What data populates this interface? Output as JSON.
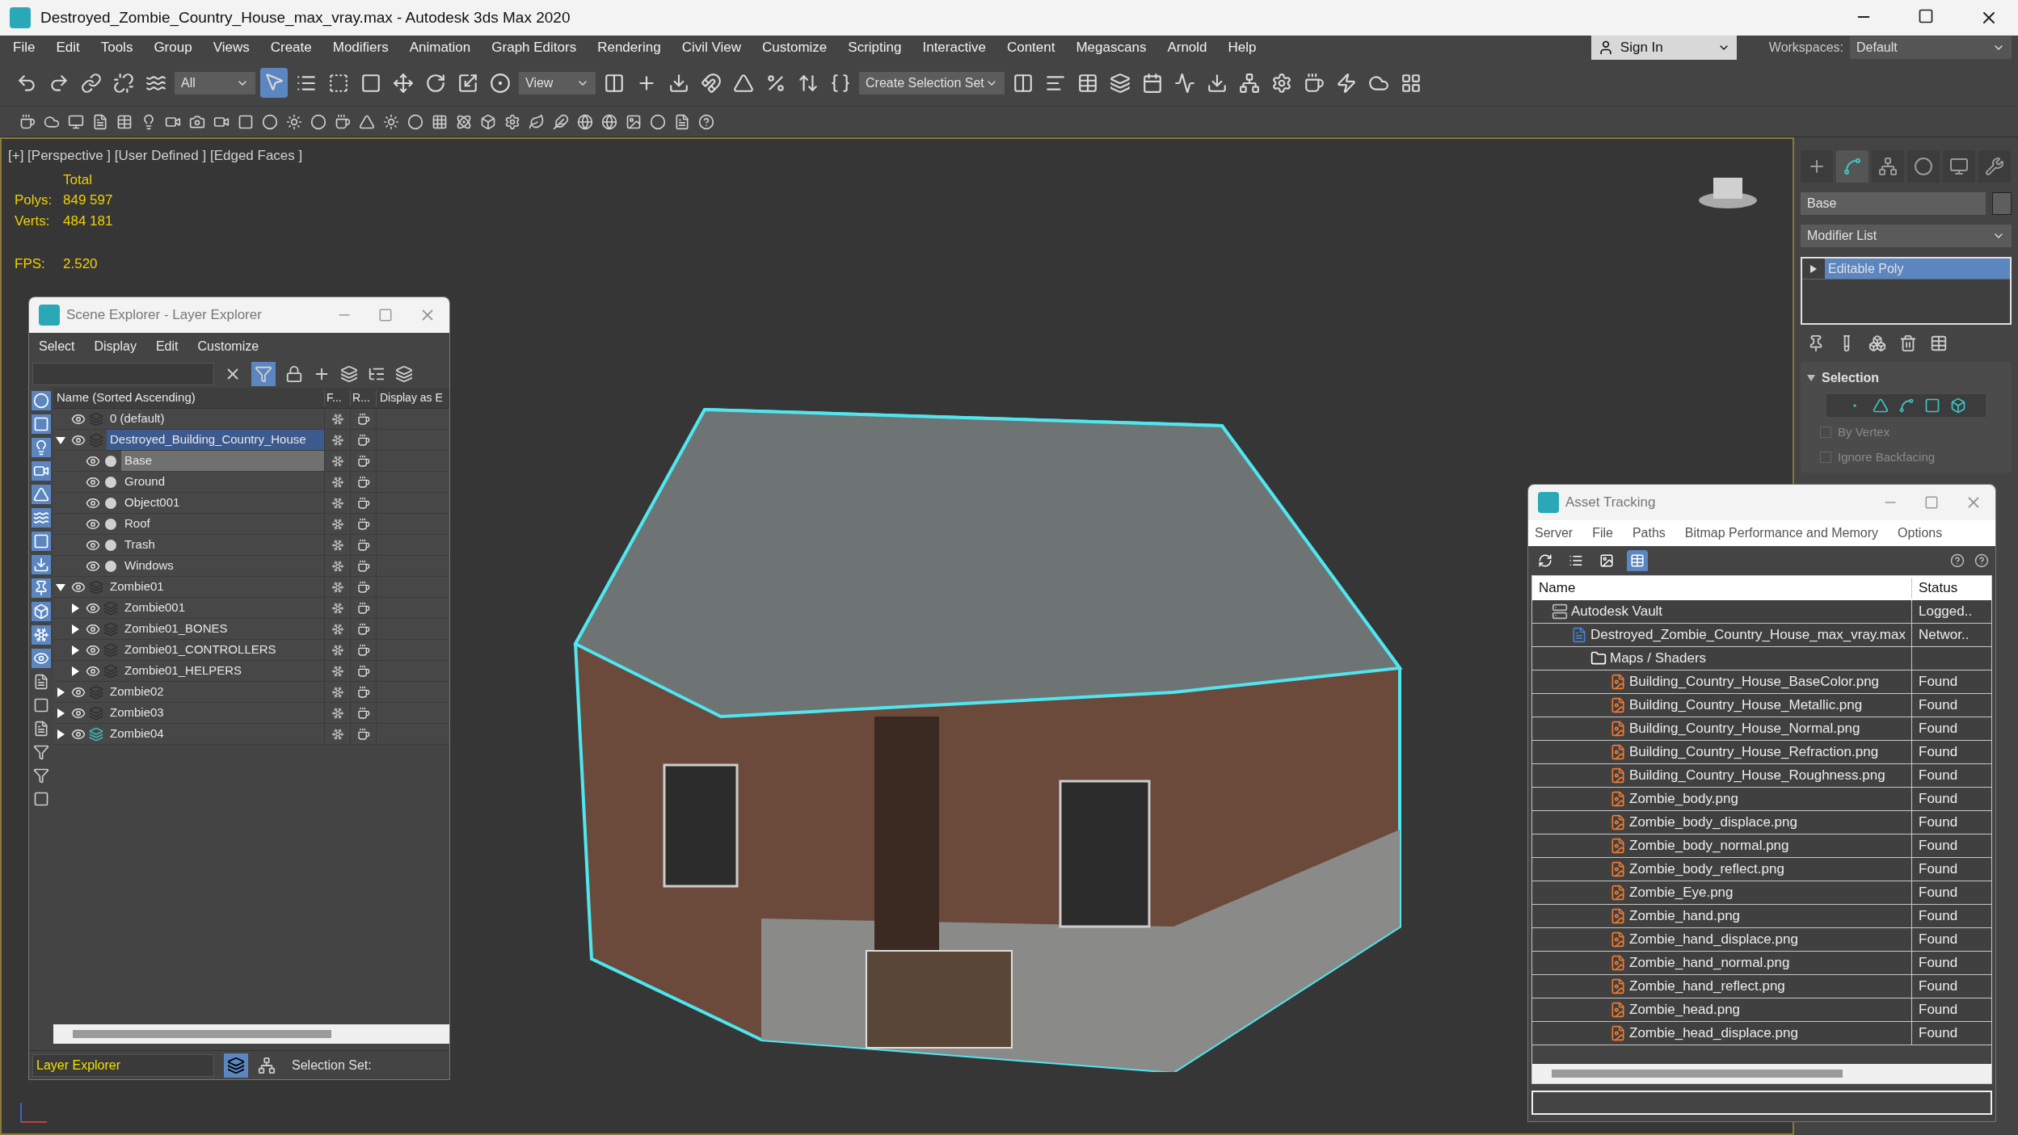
{
  "window": {
    "title": "Destroyed_Zombie_Country_House_max_vray.max - Autodesk 3ds Max 2020"
  },
  "menu": [
    "File",
    "Edit",
    "Tools",
    "Group",
    "Views",
    "Create",
    "Modifiers",
    "Animation",
    "Graph Editors",
    "Rendering",
    "Civil View",
    "Customize",
    "Scripting",
    "Interactive",
    "Content",
    "Megascans",
    "Arnold",
    "Help"
  ],
  "toolbar": {
    "selection_filter": "All",
    "reference_coord": "View",
    "selection_set": "Create Selection Set"
  },
  "account": {
    "sign_in": "Sign In",
    "workspaces_label": "Workspaces:",
    "workspace": "Default"
  },
  "viewport": {
    "labels": "[+] [Perspective ] [User Defined ] [Edged Faces ]",
    "stats_header": "Total",
    "stats": [
      {
        "label": "Polys:",
        "value": "849 597"
      },
      {
        "label": "Verts:",
        "value": "484 181"
      },
      {
        "label": "FPS:",
        "value": "2.520"
      }
    ]
  },
  "scene_explorer": {
    "title": "Scene Explorer - Layer Explorer",
    "menu": [
      "Select",
      "Display",
      "Edit",
      "Customize"
    ],
    "columns": [
      "Name (Sorted Ascending)",
      "F...",
      "R...",
      "Display as E"
    ],
    "tree": [
      {
        "name": "0 (default)",
        "kind": "layer",
        "selected": false,
        "current": false
      },
      {
        "name": "Destroyed_Building_Country_House",
        "kind": "layer",
        "expanded": true,
        "selected": true,
        "current": false,
        "children": [
          {
            "name": "Base",
            "kind": "object",
            "selected": true
          },
          {
            "name": "Ground",
            "kind": "object",
            "selected": false
          },
          {
            "name": "Object001",
            "kind": "object",
            "selected": false
          },
          {
            "name": "Roof",
            "kind": "object",
            "selected": false
          },
          {
            "name": "Trash",
            "kind": "object",
            "selected": false
          },
          {
            "name": "Windows",
            "kind": "object",
            "selected": false
          }
        ]
      },
      {
        "name": "Zombie01",
        "kind": "layer",
        "expanded": true,
        "selected": false,
        "current": false,
        "children": [
          {
            "name": "Zombie001",
            "kind": "layer",
            "expanded": false,
            "selected": false,
            "current": false
          },
          {
            "name": "Zombie01_BONES",
            "kind": "layer",
            "expanded": false,
            "selected": false,
            "current": false
          },
          {
            "name": "Zombie01_CONTROLLERS",
            "kind": "layer",
            "expanded": false,
            "selected": false,
            "current": false
          },
          {
            "name": "Zombie01_HELPERS",
            "kind": "layer",
            "expanded": false,
            "selected": false,
            "current": false
          }
        ]
      },
      {
        "name": "Zombie02",
        "kind": "layer",
        "expanded": false,
        "selected": false,
        "current": false
      },
      {
        "name": "Zombie03",
        "kind": "layer",
        "expanded": false,
        "selected": false,
        "current": false
      },
      {
        "name": "Zombie04",
        "kind": "layer",
        "expanded": false,
        "selected": false,
        "current": true
      }
    ],
    "explorer_type": "Layer Explorer",
    "selection_set_label": "Selection Set:"
  },
  "command_panel": {
    "object_name": "Base",
    "modifier_list": "Modifier List",
    "stack": [
      {
        "name": "Editable Poly",
        "selected": true
      }
    ],
    "rollout": {
      "title": "Selection",
      "expanded": true,
      "options": [
        {
          "label": "By Vertex",
          "checked": false,
          "disabled": true
        },
        {
          "label": "Ignore Backfacing",
          "checked": false,
          "disabled": true
        }
      ]
    }
  },
  "asset_tracking": {
    "title": "Asset Tracking",
    "menu": [
      "Server",
      "File",
      "Paths",
      "Bitmap Performance and Memory",
      "Options"
    ],
    "view_buttons": [
      {
        "selected": false
      },
      {
        "selected": false
      },
      {
        "selected": false
      },
      {
        "selected": true
      }
    ],
    "columns": [
      "Name",
      "Status"
    ],
    "rows": [
      {
        "name": "Autodesk Vault",
        "kind": "vault",
        "status": "Logged..",
        "children": [
          {
            "name": "Destroyed_Zombie_Country_House_max_vray.max",
            "kind": "scene",
            "status": "Networ..",
            "children": [
              {
                "name": "Maps / Shaders",
                "kind": "folder",
                "children": [
                  {
                    "name": "Building_Country_House_BaseColor.png",
                    "kind": "image",
                    "status": "Found"
                  },
                  {
                    "name": "Building_Country_House_Metallic.png",
                    "kind": "image",
                    "status": "Found"
                  },
                  {
                    "name": "Building_Country_House_Normal.png",
                    "kind": "image",
                    "status": "Found"
                  },
                  {
                    "name": "Building_Country_House_Refraction.png",
                    "kind": "image",
                    "status": "Found"
                  },
                  {
                    "name": "Building_Country_House_Roughness.png",
                    "kind": "image",
                    "status": "Found"
                  },
                  {
                    "name": "Zombie_body.png",
                    "kind": "image",
                    "status": "Found"
                  },
                  {
                    "name": "Zombie_body_displace.png",
                    "kind": "image",
                    "status": "Found"
                  },
                  {
                    "name": "Zombie_body_normal.png",
                    "kind": "image",
                    "status": "Found"
                  },
                  {
                    "name": "Zombie_body_reflect.png",
                    "kind": "image",
                    "status": "Found"
                  },
                  {
                    "name": "Zombie_Eye.png",
                    "kind": "image",
                    "status": "Found"
                  },
                  {
                    "name": "Zombie_hand.png",
                    "kind": "image",
                    "status": "Found"
                  },
                  {
                    "name": "Zombie_hand_displace.png",
                    "kind": "image",
                    "status": "Found"
                  },
                  {
                    "name": "Zombie_hand_normal.png",
                    "kind": "image",
                    "status": "Found"
                  },
                  {
                    "name": "Zombie_hand_reflect.png",
                    "kind": "image",
                    "status": "Found"
                  },
                  {
                    "name": "Zombie_head.png",
                    "kind": "image",
                    "status": "Found"
                  },
                  {
                    "name": "Zombie_head_displace.png",
                    "kind": "image",
                    "status": "Found"
                  }
                ]
              }
            ]
          }
        ]
      }
    ]
  }
}
